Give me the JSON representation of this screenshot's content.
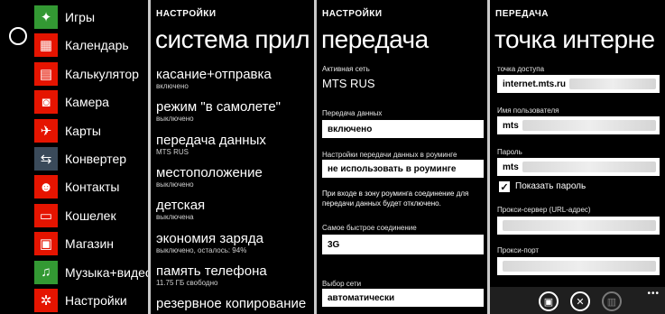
{
  "apps": [
    {
      "label": "Игры",
      "icon": "gamepad-icon",
      "glyph": "✦",
      "color": "green"
    },
    {
      "label": "Календарь",
      "icon": "calendar-icon",
      "glyph": "▦",
      "color": "red"
    },
    {
      "label": "Калькулятор",
      "icon": "calculator-icon",
      "glyph": "▤",
      "color": "red"
    },
    {
      "label": "Камера",
      "icon": "camera-icon",
      "glyph": "◙",
      "color": "red"
    },
    {
      "label": "Карты",
      "icon": "maps-icon",
      "glyph": "✈",
      "color": "red"
    },
    {
      "label": "Конвертер",
      "icon": "converter-icon",
      "glyph": "⇆",
      "color": "gray"
    },
    {
      "label": "Контакты",
      "icon": "contacts-icon",
      "glyph": "☻",
      "color": "red"
    },
    {
      "label": "Кошелек",
      "icon": "wallet-icon",
      "glyph": "▭",
      "color": "red"
    },
    {
      "label": "Магазин",
      "icon": "store-icon",
      "glyph": "▣",
      "color": "red"
    },
    {
      "label": "Музыка+видео",
      "icon": "music-icon",
      "glyph": "♫",
      "color": "green"
    },
    {
      "label": "Настройки",
      "icon": "settings-icon",
      "glyph": "✲",
      "color": "red"
    }
  ],
  "system": {
    "eyebrow": "НАСТРОЙКИ",
    "title": "система прил",
    "items": [
      {
        "title": "касание+отправка",
        "sub": "включено"
      },
      {
        "title": "режим \"в самолете\"",
        "sub": "выключено"
      },
      {
        "title": "передача данных",
        "sub": "MTS RUS"
      },
      {
        "title": "местоположение",
        "sub": "выключено"
      },
      {
        "title": "детская",
        "sub": "выключена"
      },
      {
        "title": "экономия заряда",
        "sub": "выключено, осталось: 94%"
      },
      {
        "title": "память телефона",
        "sub": "11.75 ГБ свободно"
      },
      {
        "title": "резервное копирование",
        "sub": ""
      }
    ]
  },
  "transfer": {
    "eyebrow": "НАСТРОЙКИ",
    "title": "передача",
    "active_network_label": "Активная сеть",
    "active_network_value": "MTS RUS",
    "data_label": "Передача данных",
    "data_value": "включено",
    "roaming_label": "Настройки передачи данных в роуминге",
    "roaming_value": "не использовать в роуминге",
    "roaming_note": "При входе в зону роуминга соединение для передачи данных будет отключено.",
    "fastest_label": "Самое быстрое соединение",
    "fastest_value": "3G",
    "network_label": "Выбор сети",
    "network_value": "автоматически"
  },
  "hotspot": {
    "eyebrow": "ПЕРЕДАЧА",
    "title": "точка интерне",
    "apn_label": "точка доступа",
    "apn_value": "internet.mts.ru",
    "user_label": "Имя пользователя",
    "user_value": "mts",
    "pass_label": "Пароль",
    "pass_value": "mts",
    "show_pass_label": "Показать пароль",
    "show_pass_checked": true,
    "proxy_label": "Прокси-сервер (URL-адрес)",
    "port_label": "Прокси-порт",
    "more": "•••"
  }
}
